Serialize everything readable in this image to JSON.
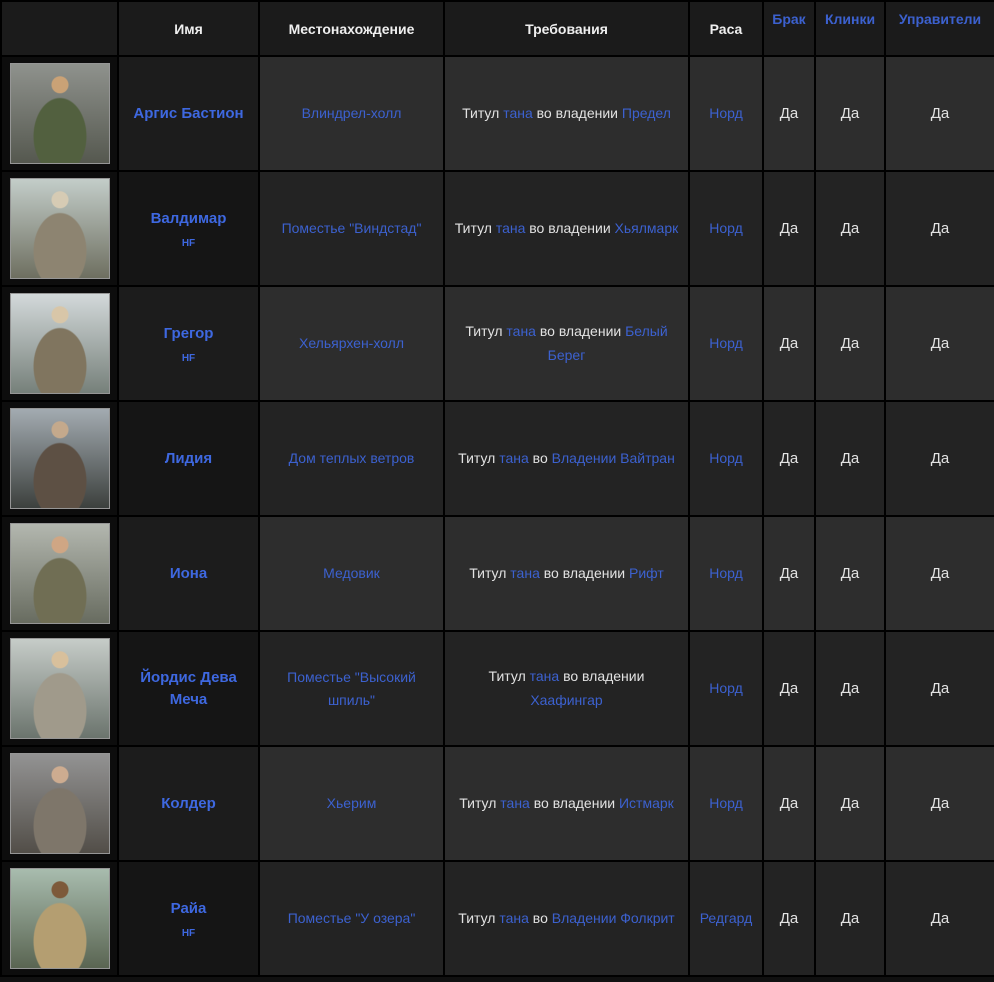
{
  "colors": {
    "page_bg": "#101010",
    "border": "#000000",
    "header_bg": "#1b1b1b",
    "header_text": "#efefef",
    "row_bg_odd": "#2d2d2d",
    "row_bg_even": "#232323",
    "name_cell_bg": "#1a1a1a",
    "photo_cell_bg": "#0d0d0d",
    "body_text": "#e2e2e2",
    "link_color": "#3c61cf",
    "name_link_color": "#3e68e0"
  },
  "table": {
    "headers": [
      {
        "key": "photo",
        "label": "",
        "link": false
      },
      {
        "key": "name",
        "label": "Имя",
        "link": false
      },
      {
        "key": "location",
        "label": "Местонахождение",
        "link": false
      },
      {
        "key": "requirements",
        "label": "Требования",
        "link": false
      },
      {
        "key": "race",
        "label": "Раса",
        "link": false
      },
      {
        "key": "marriage",
        "label": "Брак",
        "link": true
      },
      {
        "key": "blades",
        "label": "Клинки",
        "link": true
      },
      {
        "key": "stewards",
        "label": "Управители",
        "link": true
      }
    ],
    "rows": [
      {
        "name": "Аргис Бастион",
        "dlc": "",
        "portrait": {
          "id": "portrait-argis-bastion",
          "bg_top": "#8f928d",
          "bg_bottom": "#55584f",
          "armor": "#52603f",
          "skin": "#caa276"
        },
        "location": "Влиндрел-холл",
        "requirements": [
          {
            "text": "Титул ",
            "link": false
          },
          {
            "text": "тана",
            "link": true
          },
          {
            "text": " во владении ",
            "link": false
          },
          {
            "text": "Предел",
            "link": true
          }
        ],
        "race": "Норд",
        "marriage": "Да",
        "blades": "Да",
        "steward": "Да"
      },
      {
        "name": "Валдимар",
        "dlc": "HF",
        "portrait": {
          "id": "portrait-valdimar",
          "bg_top": "#c3cdc9",
          "bg_bottom": "#6e6f60",
          "armor": "#8d8471",
          "skin": "#d6cbb4"
        },
        "location": "Поместье \"Виндстад\"",
        "requirements": [
          {
            "text": "Титул ",
            "link": false
          },
          {
            "text": "тана",
            "link": true
          },
          {
            "text": " во владении ",
            "link": false
          },
          {
            "text": "Хьялмарк",
            "link": true
          }
        ],
        "race": "Норд",
        "marriage": "Да",
        "blades": "Да",
        "steward": "Да"
      },
      {
        "name": "Грегор",
        "dlc": "HF",
        "portrait": {
          "id": "portrait-gregor",
          "bg_top": "#d3d9da",
          "bg_bottom": "#76807a",
          "armor": "#80755f",
          "skin": "#d8c6a8"
        },
        "location": "Хельярхен-холл",
        "requirements": [
          {
            "text": "Титул ",
            "link": false
          },
          {
            "text": "тана",
            "link": true
          },
          {
            "text": " во владении ",
            "link": false
          },
          {
            "text": "Белый Берег",
            "link": true
          }
        ],
        "race": "Норд",
        "marriage": "Да",
        "blades": "Да",
        "steward": "Да"
      },
      {
        "name": "Лидия",
        "dlc": "",
        "portrait": {
          "id": "portrait-lydia",
          "bg_top": "#a3abb1",
          "bg_bottom": "#3c403d",
          "armor": "#5d5044",
          "skin": "#c4a98c"
        },
        "location": "Дом теплых ветров",
        "requirements": [
          {
            "text": "Титул ",
            "link": false
          },
          {
            "text": "тана",
            "link": true
          },
          {
            "text": " во ",
            "link": false
          },
          {
            "text": "Владении Вайтран",
            "link": true
          }
        ],
        "race": "Норд",
        "marriage": "Да",
        "blades": "Да",
        "steward": "Да"
      },
      {
        "name": "Иона",
        "dlc": "",
        "portrait": {
          "id": "portrait-iona",
          "bg_top": "#b3b7af",
          "bg_bottom": "#686c60",
          "armor": "#706e54",
          "skin": "#cfa684"
        },
        "location": "Медовик",
        "requirements": [
          {
            "text": "Титул ",
            "link": false
          },
          {
            "text": "тана",
            "link": true
          },
          {
            "text": " во владении ",
            "link": false
          },
          {
            "text": "Рифт",
            "link": true
          }
        ],
        "race": "Норд",
        "marriage": "Да",
        "blades": "Да",
        "steward": "Да"
      },
      {
        "name": "Йордис Дева Меча",
        "dlc": "",
        "portrait": {
          "id": "portrait-jordis",
          "bg_top": "#c6ccc8",
          "bg_bottom": "#6b746d",
          "armor": "#a09a8b",
          "skin": "#d8c09c"
        },
        "location": "Поместье \"Высокий шпиль\"",
        "requirements": [
          {
            "text": "Титул ",
            "link": false
          },
          {
            "text": "тана",
            "link": true
          },
          {
            "text": " во владении ",
            "link": false
          },
          {
            "text": "Хаафингар",
            "link": true
          }
        ],
        "race": "Норд",
        "marriage": "Да",
        "blades": "Да",
        "steward": "Да"
      },
      {
        "name": "Колдер",
        "dlc": "",
        "portrait": {
          "id": "portrait-calder",
          "bg_top": "#939393",
          "bg_bottom": "#524e48",
          "armor": "#7e766a",
          "skin": "#cdac90"
        },
        "location": "Хьерим",
        "requirements": [
          {
            "text": "Титул ",
            "link": false
          },
          {
            "text": "тана",
            "link": true
          },
          {
            "text": " во владении ",
            "link": false
          },
          {
            "text": "Истмарк",
            "link": true
          }
        ],
        "race": "Норд",
        "marriage": "Да",
        "blades": "Да",
        "steward": "Да"
      },
      {
        "name": "Райа",
        "dlc": "HF",
        "portrait": {
          "id": "portrait-rayya",
          "bg_top": "#a8bcae",
          "bg_bottom": "#5a6552",
          "armor": "#b49e71",
          "skin": "#7d5a3a"
        },
        "location": "Поместье \"У озера\"",
        "requirements": [
          {
            "text": "Титул ",
            "link": false
          },
          {
            "text": "тана",
            "link": true
          },
          {
            "text": " во ",
            "link": false
          },
          {
            "text": "Владении Фолкрит",
            "link": true
          }
        ],
        "race": "Редгард",
        "marriage": "Да",
        "blades": "Да",
        "steward": "Да"
      }
    ]
  }
}
